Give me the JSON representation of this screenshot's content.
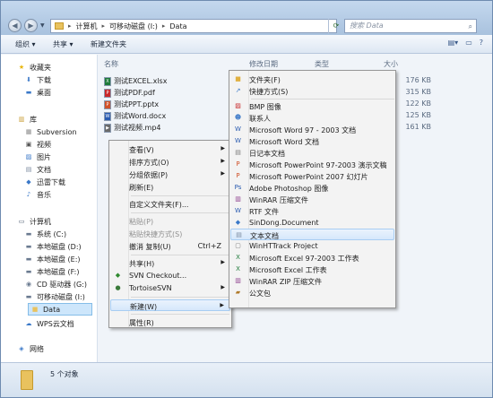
{
  "address": {
    "crumbs": [
      "计算机",
      "可移动磁盘 (I:)",
      "Data"
    ]
  },
  "search": {
    "placeholder": "搜索 Data"
  },
  "toolbar": {
    "organize": "组织 ▾",
    "share": "共享 ▾",
    "new_folder": "新建文件夹"
  },
  "nav": {
    "favorites": "收藏夹",
    "downloads": "下载",
    "desktop": "桌面",
    "library": "库",
    "subversion": "Subversion",
    "videos": "视频",
    "pictures": "图片",
    "documents": "文档",
    "thunder": "迅雷下载",
    "music": "音乐",
    "computer": "计算机",
    "system_c": "系统 (C:)",
    "disk_d": "本地磁盘 (D:)",
    "disk_e": "本地磁盘 (E:)",
    "disk_f": "本地磁盘 (F:)",
    "cd_g": "CD 驱动器 (G:)",
    "removable_i": "可移动磁盘 (I:)",
    "data": "Data",
    "wps": "WPS云文档",
    "network": "网络"
  },
  "columns": {
    "name": "名称",
    "modified": "修改日期",
    "type": "类型",
    "size": "大小"
  },
  "files": [
    {
      "name": "测试EXCEL.xlsx",
      "size": "176 KB"
    },
    {
      "name": "测试PDF.pdf",
      "size": "315 KB"
    },
    {
      "name": "测试PPT.pptx",
      "size": "122 KB"
    },
    {
      "name": "测试Word.docx",
      "size": "125 KB"
    },
    {
      "name": "测试视频.mp4",
      "size": "161 KB"
    }
  ],
  "status": {
    "count": "5 个对象"
  },
  "context_menu": {
    "view": "查看(V)",
    "sort": "排序方式(O)",
    "group": "分组依据(P)",
    "refresh": "刷新(E)",
    "customize": "自定义文件夹(F)...",
    "paste": "粘贴(P)",
    "paste_shortcut": "粘贴快捷方式(S)",
    "undo_copy": "撤消 复制(U)",
    "undo_shortcut": "Ctrl+Z",
    "share": "共享(H)",
    "svn_checkout": "SVN Checkout...",
    "tortoisesvn": "TortoiseSVN",
    "new": "新建(W)",
    "properties": "属性(R)"
  },
  "new_menu": {
    "items": [
      "文件夹(F)",
      "快捷方式(S)",
      "BMP 图像",
      "联系人",
      "Microsoft Word 97 - 2003 文档",
      "Microsoft Word 文档",
      "日记本文档",
      "Microsoft PowerPoint 97-2003 演示文稿",
      "Microsoft PowerPoint 2007 幻灯片",
      "Adobe Photoshop 图像",
      "WinRAR 压缩文件",
      "RTF 文件",
      "SinDong.Document",
      "文本文档",
      "WinHTTrack Project",
      "Microsoft Excel 97-2003 工作表",
      "Microsoft Excel 工作表",
      "WinRAR ZIP 压缩文件",
      "公文包"
    ]
  }
}
